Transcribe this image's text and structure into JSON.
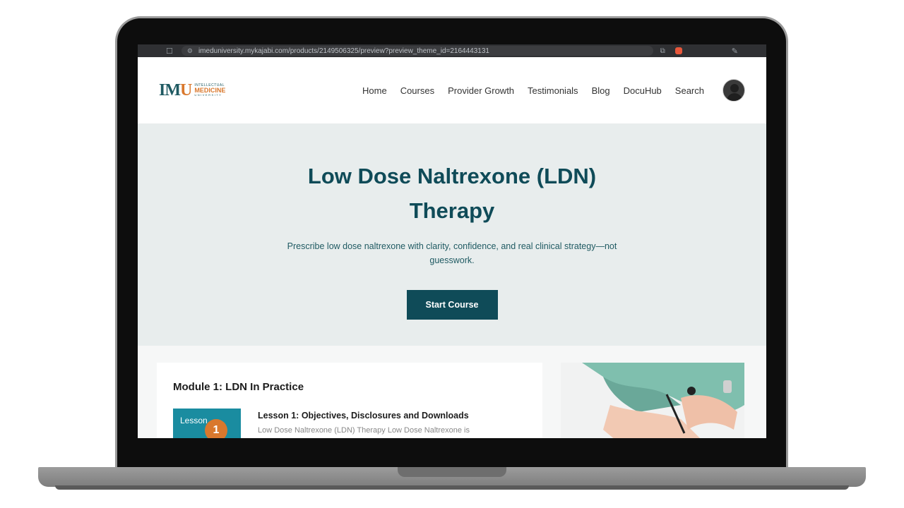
{
  "browser": {
    "url": "imeduniversity.mykajabi.com/products/2149506325/preview?preview_theme_id=2164443131"
  },
  "brand": {
    "mark": "IM",
    "mark_plus": "U",
    "line1": "INTELLECTUAL",
    "line2": "MEDICINE",
    "line3": "UNIVERSITY"
  },
  "nav": {
    "items": [
      "Home",
      "Courses",
      "Provider Growth",
      "Testimonials",
      "Blog",
      "DocuHub",
      "Search"
    ]
  },
  "hero": {
    "title": "Low Dose Naltrexone (LDN) Therapy",
    "subtitle": "Prescribe low dose naltrexone with clarity, confidence, and real clinical strategy—not guesswork.",
    "cta_label": "Start Course"
  },
  "module": {
    "title": "Module 1: LDN In Practice",
    "lessons": [
      {
        "thumb_label": "Lesson",
        "number": "1",
        "title": "Lesson 1: Objectives, Disclosures and Downloads",
        "description": "Low Dose Naltrexone (LDN) Therapy Low Dose Naltrexone is"
      }
    ]
  },
  "colors": {
    "primary": "#0f4b58",
    "accent": "#d9782d",
    "hero_bg": "#e8eded",
    "lesson_thumb": "#1a8ca0"
  },
  "icons": [
    "bookmark-icon",
    "site-info-icon",
    "share-icon",
    "extension-icon",
    "pen-icon",
    "avatar-icon"
  ]
}
